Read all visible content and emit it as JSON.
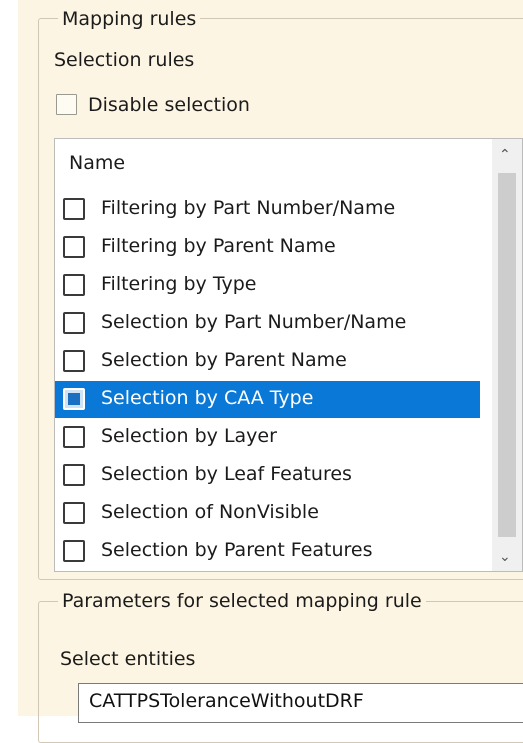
{
  "mapping_rules": {
    "group_title": "Mapping rules",
    "selection_rules_label": "Selection rules",
    "disable_selection": {
      "label": "Disable selection",
      "checked": false
    }
  },
  "rules_list": {
    "column_header": "Name",
    "items": [
      {
        "label": "Filtering by Part Number/Name",
        "checked": false,
        "selected": false
      },
      {
        "label": "Filtering by Parent Name",
        "checked": false,
        "selected": false
      },
      {
        "label": "Filtering by Type",
        "checked": false,
        "selected": false
      },
      {
        "label": "Selection by Part Number/Name",
        "checked": false,
        "selected": false
      },
      {
        "label": "Selection by Parent Name",
        "checked": false,
        "selected": false
      },
      {
        "label": "Selection by CAA Type",
        "checked": true,
        "selected": true
      },
      {
        "label": "Selection by Layer",
        "checked": false,
        "selected": false
      },
      {
        "label": "Selection by Leaf Features",
        "checked": false,
        "selected": false
      },
      {
        "label": "Selection of NonVisible",
        "checked": false,
        "selected": false
      },
      {
        "label": "Selection by Parent Features",
        "checked": false,
        "selected": false
      }
    ]
  },
  "parameters": {
    "group_title": "Parameters for selected mapping rule",
    "select_entities_label": "Select entities",
    "select_entities_value": "CATTPSToleranceWithoutDRF"
  },
  "colors": {
    "panel_background": "#fdf5e3",
    "selection_highlight": "#0a78d7"
  }
}
